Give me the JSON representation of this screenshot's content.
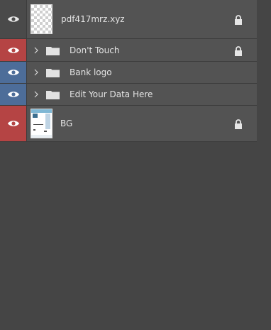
{
  "layers": [
    {
      "name": "pdf417mrz.xyz",
      "eye": "plain",
      "type": "image-transparent",
      "locked": true,
      "expandable": false
    },
    {
      "name": "Don't Touch",
      "eye": "red",
      "type": "group",
      "locked": true,
      "expandable": true
    },
    {
      "name": "Bank logo",
      "eye": "blue",
      "type": "group",
      "locked": false,
      "expandable": true
    },
    {
      "name": "Edit Your Data Here",
      "eye": "blue",
      "type": "group",
      "locked": false,
      "expandable": true
    },
    {
      "name": "BG",
      "eye": "red",
      "type": "image-document",
      "locked": true,
      "expandable": false
    }
  ],
  "colors": {
    "panel_bg": "#454545",
    "row_bg": "#535353",
    "eye_red": "#b54444",
    "eye_blue": "#4d6d99",
    "text": "#e4e4e4"
  },
  "icons": {
    "visibility": "eye-icon",
    "expand": "chevron-right-icon",
    "folder": "folder-icon",
    "lock": "lock-icon"
  }
}
